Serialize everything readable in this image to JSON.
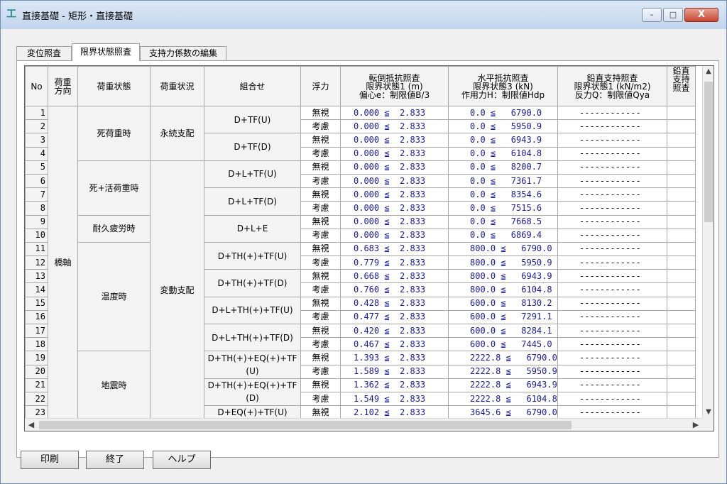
{
  "window": {
    "title": "直接基礎 - 矩形・直接基礎",
    "minimize": "–",
    "maximize": "□",
    "close": "X"
  },
  "tabs": [
    "変位照査",
    "限界状態照査",
    "支持力係数の編集"
  ],
  "headers": {
    "no": "No",
    "load_dir": [
      "荷重",
      "方向"
    ],
    "load_state": "荷重状態",
    "load_case": "荷重状況",
    "combo": "組合せ",
    "float": "浮力",
    "ot": [
      "転倒抵抗照査",
      "限界状態1 (m)",
      "偏心e：制限値B/3"
    ],
    "hr": [
      "水平抵抗照査",
      "限界状態3 (kN)",
      "作用力H：制限値Hdp"
    ],
    "vt": [
      "鉛直支持照査",
      "限界状態1 (kN/m2)",
      "反力Q：制限値Qya"
    ],
    "extra": [
      "鉛直",
      "支持",
      "照査"
    ]
  },
  "direction": "橋軸",
  "groups": [
    {
      "state": "死荷重時",
      "rows": 4
    },
    {
      "state": "死+活荷重時",
      "rows": 4
    },
    {
      "state": "耐久疲労時",
      "rows": 2
    },
    {
      "state": "温度時",
      "rows": 8
    },
    {
      "state": "地震時",
      "rows": 5
    }
  ],
  "cases": [
    {
      "label": "永続支配",
      "rows": 4
    },
    {
      "label": "変動支配",
      "rows": 19
    }
  ],
  "combos": [
    {
      "label": "D+TF(U)",
      "rows": 2
    },
    {
      "label": "D+TF(D)",
      "rows": 2
    },
    {
      "label": "D+L+TF(U)",
      "rows": 2
    },
    {
      "label": "D+L+TF(D)",
      "rows": 2
    },
    {
      "label": "D+L+E",
      "rows": 2
    },
    {
      "label": "D+TH(+)+TF(U)",
      "rows": 2
    },
    {
      "label": "D+TH(+)+TF(D)",
      "rows": 2
    },
    {
      "label": "D+L+TH(+)+TF(U)",
      "rows": 2
    },
    {
      "label": "D+L+TH(+)+TF(D)",
      "rows": 2
    },
    {
      "label": "D+TH(+)+EQ(+)+TF(U)",
      "rows": 2
    },
    {
      "label": "D+TH(+)+EQ(+)+TF(D)",
      "rows": 2
    },
    {
      "label": "D+EQ(+)+TF(U)",
      "rows": 1
    }
  ],
  "rows": [
    {
      "no": "1",
      "float": "無視",
      "ot": "0.000 ≦  2.833",
      "hr": "0.0 ≦   6790.0",
      "vt": "------------"
    },
    {
      "no": "2",
      "float": "考慮",
      "ot": "0.000 ≦  2.833",
      "hr": "0.0 ≦   5950.9",
      "vt": "------------"
    },
    {
      "no": "3",
      "float": "無視",
      "ot": "0.000 ≦  2.833",
      "hr": "0.0 ≦   6943.9",
      "vt": "------------"
    },
    {
      "no": "4",
      "float": "考慮",
      "ot": "0.000 ≦  2.833",
      "hr": "0.0 ≦   6104.8",
      "vt": "------------"
    },
    {
      "no": "5",
      "float": "無視",
      "ot": "0.000 ≦  2.833",
      "hr": "0.0 ≦   8200.7",
      "vt": "------------"
    },
    {
      "no": "6",
      "float": "考慮",
      "ot": "0.000 ≦  2.833",
      "hr": "0.0 ≦   7361.7",
      "vt": "------------"
    },
    {
      "no": "7",
      "float": "無視",
      "ot": "0.000 ≦  2.833",
      "hr": "0.0 ≦   8354.6",
      "vt": "------------"
    },
    {
      "no": "8",
      "float": "考慮",
      "ot": "0.000 ≦  2.833",
      "hr": "0.0 ≦   7515.6",
      "vt": "------------"
    },
    {
      "no": "9",
      "float": "無視",
      "ot": "0.000 ≦  2.833",
      "hr": "0.0 ≦   7668.5",
      "vt": "------------"
    },
    {
      "no": "10",
      "float": "考慮",
      "ot": "0.000 ≦  2.833",
      "hr": "0.0 ≦   6869.4",
      "vt": "------------"
    },
    {
      "no": "11",
      "float": "無視",
      "ot": "0.683 ≦  2.833",
      "hr": "800.0 ≦   6790.0",
      "vt": "------------"
    },
    {
      "no": "12",
      "float": "考慮",
      "ot": "0.779 ≦  2.833",
      "hr": "800.0 ≦   5950.9",
      "vt": "------------"
    },
    {
      "no": "13",
      "float": "無視",
      "ot": "0.668 ≦  2.833",
      "hr": "800.0 ≦   6943.9",
      "vt": "------------"
    },
    {
      "no": "14",
      "float": "考慮",
      "ot": "0.760 ≦  2.833",
      "hr": "800.0 ≦   6104.8",
      "vt": "------------"
    },
    {
      "no": "15",
      "float": "無視",
      "ot": "0.428 ≦  2.833",
      "hr": "600.0 ≦   8130.2",
      "vt": "------------"
    },
    {
      "no": "16",
      "float": "考慮",
      "ot": "0.477 ≦  2.833",
      "hr": "600.0 ≦   7291.1",
      "vt": "------------"
    },
    {
      "no": "17",
      "float": "無視",
      "ot": "0.420 ≦  2.833",
      "hr": "600.0 ≦   8284.1",
      "vt": "------------"
    },
    {
      "no": "18",
      "float": "考慮",
      "ot": "0.467 ≦  2.833",
      "hr": "600.0 ≦   7445.0",
      "vt": "------------"
    },
    {
      "no": "19",
      "float": "無視",
      "ot": "1.393 ≦  2.833",
      "hr": "2222.8 ≦   6790.0",
      "vt": "------------"
    },
    {
      "no": "20",
      "float": "考慮",
      "ot": "1.589 ≦  2.833",
      "hr": "2222.8 ≦   5950.9",
      "vt": "------------"
    },
    {
      "no": "21",
      "float": "無視",
      "ot": "1.362 ≦  2.833",
      "hr": "2222.8 ≦   6943.9",
      "vt": "------------"
    },
    {
      "no": "22",
      "float": "考慮",
      "ot": "1.549 ≦  2.833",
      "hr": "2222.8 ≦   6104.8",
      "vt": "------------"
    },
    {
      "no": "23",
      "float": "無視",
      "ot": "2.102 ≦  2.833",
      "hr": "3645.6 ≦   6790.0",
      "vt": "------------"
    }
  ],
  "buttons": {
    "print": "印刷",
    "exit": "終了",
    "help": "ヘルプ"
  },
  "scroll": {
    "up": "▲",
    "down": "▼",
    "left": "◀",
    "right": "▶"
  }
}
